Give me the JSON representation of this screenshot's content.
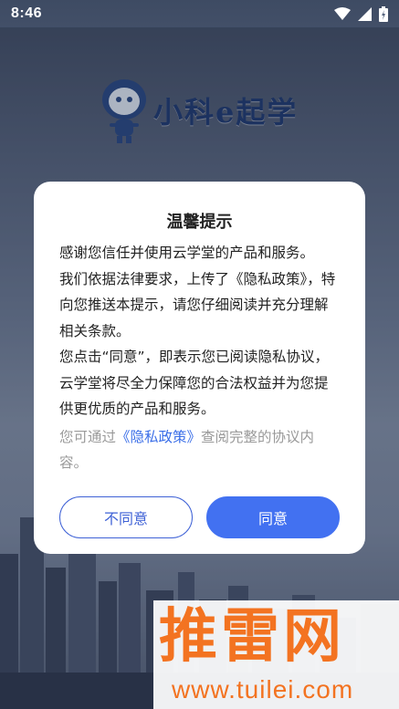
{
  "status_bar": {
    "time": "8:46",
    "icons": [
      "wifi-icon",
      "signal-icon",
      "battery-icon"
    ]
  },
  "app": {
    "logo_text": "小科e起学"
  },
  "dialog": {
    "title": "温馨提示",
    "paragraph_1": "感谢您信任并使用云学堂的产品和服务。",
    "paragraph_2": "我们依据法律要求，上传了《隐私政策》，特向您推送本提示，请您仔细阅读并充分理解相关条款。",
    "paragraph_3": "您点击“同意”，即表示您已阅读隐私协议，云学堂将尽全力保障您的合法权益并为您提供更优质的产品和服务。",
    "note_prefix": "您可通过",
    "note_link": "《隐私政策》",
    "note_suffix": "查阅完整的协议内容。",
    "disagree_label": "不同意",
    "agree_label": "同意"
  },
  "watermark": {
    "main": "推雷网",
    "sub": "www.tuilei.com"
  },
  "colors": {
    "accent": "#4271f1",
    "link": "#3a6ee8",
    "watermark": "#f37321"
  }
}
